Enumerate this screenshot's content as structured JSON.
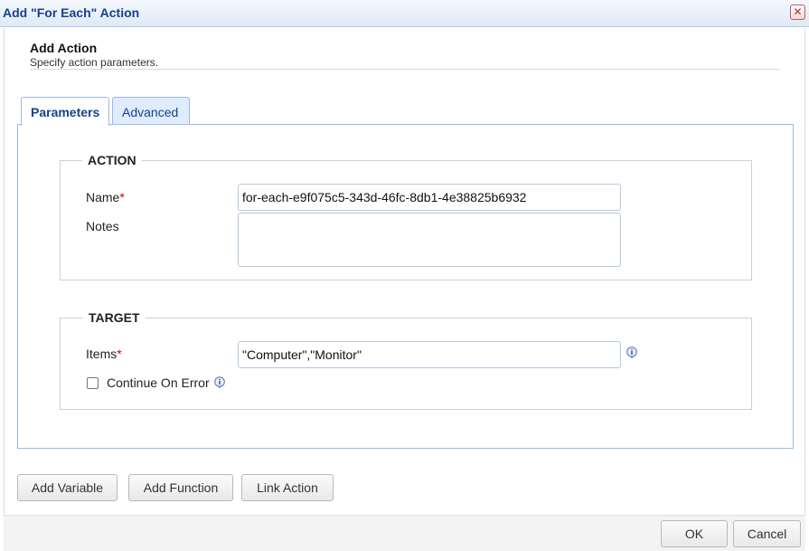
{
  "window": {
    "title": "Add \"For Each\" Action",
    "close_glyph": "✕"
  },
  "header": {
    "title": "Add Action",
    "subtitle": "Specify action parameters."
  },
  "tabs": [
    {
      "label": "Parameters",
      "active": true
    },
    {
      "label": "Advanced",
      "active": false
    }
  ],
  "action_group": {
    "legend": "ACTION",
    "name_label": "Name",
    "name_value": "for-each-e9f075c5-343d-46fc-8db1-4e38825b6932",
    "notes_label": "Notes",
    "notes_value": ""
  },
  "target_group": {
    "legend": "TARGET",
    "items_label": "Items",
    "items_value": "\"Computer\",\"Monitor\"",
    "continue_label": "Continue On Error",
    "continue_checked": false
  },
  "required_mark": "*",
  "buttons": {
    "add_variable": "Add Variable",
    "add_function": "Add Function",
    "link_action": "Link Action",
    "ok": "OK",
    "cancel": "Cancel"
  },
  "colors": {
    "title_text": "#15428b",
    "border_blue": "#99bbe8",
    "required": "#cc0000"
  },
  "icons": {
    "close": "close-icon",
    "info": "info-icon"
  }
}
